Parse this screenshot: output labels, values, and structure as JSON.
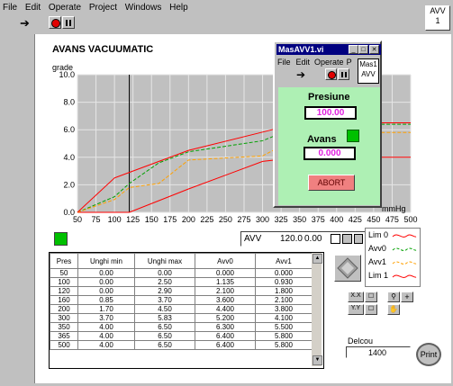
{
  "menu": [
    "File",
    "Edit",
    "Operate",
    "Project",
    "Windows",
    "Help"
  ],
  "corner_label": "AVV\n1",
  "title": "AVANS VACUUMATIC",
  "ylabel": "grade",
  "xunit": "mmHg",
  "chart_data": {
    "type": "line",
    "x_ticks": [
      50,
      75,
      100,
      125,
      150,
      175,
      200,
      225,
      250,
      275,
      300,
      325,
      350,
      375,
      400,
      425,
      450,
      475,
      500
    ],
    "y_ticks": [
      "0.0",
      "2.0",
      "4.0",
      "6.0",
      "8.0",
      "10.0"
    ],
    "xlim": [
      50,
      500
    ],
    "ylim": [
      0,
      10
    ],
    "cursor_x": 120,
    "series": [
      {
        "name": "Lim 0",
        "color": "#ff0000",
        "x": [
          50,
          100,
          120,
          160,
          200,
          300,
          350,
          500
        ],
        "y": [
          0,
          0,
          0,
          0.85,
          1.7,
          3.7,
          4,
          4
        ]
      },
      {
        "name": "Avv0",
        "color": "#00a000",
        "x": [
          50,
          100,
          120,
          160,
          200,
          300,
          350,
          365,
          500
        ],
        "y": [
          0,
          1.135,
          2.1,
          3.6,
          4.4,
          5.2,
          6.3,
          6.4,
          6.4
        ]
      },
      {
        "name": "Avv1",
        "color": "#ffa000",
        "x": [
          50,
          100,
          120,
          160,
          200,
          300,
          350,
          365,
          500
        ],
        "y": [
          0,
          0.93,
          1.8,
          2.1,
          3.8,
          4.1,
          5.5,
          5.8,
          5.8
        ]
      },
      {
        "name": "Lim 1",
        "color": "#ff0000",
        "x": [
          50,
          100,
          120,
          160,
          200,
          300,
          350,
          365,
          500
        ],
        "y": [
          0,
          2.5,
          2.9,
          3.7,
          4.5,
          5.83,
          6.5,
          6.5,
          6.5
        ]
      }
    ]
  },
  "cursor_panel": {
    "name": "AVV",
    "x": "120.0",
    "y": "0.00"
  },
  "legend": [
    "Lim 0",
    "Avv0",
    "Avv1",
    "Lim 1"
  ],
  "table": {
    "headers": [
      "Pres",
      "Unghi min",
      "Unghi max",
      "Avv0",
      "Avv1"
    ],
    "rows": [
      [
        "50",
        "0.00",
        "0.00",
        "0.000",
        "0.000"
      ],
      [
        "100",
        "0.00",
        "2.50",
        "1.135",
        "0.930"
      ],
      [
        "120",
        "0.00",
        "2.90",
        "2.100",
        "1.800"
      ],
      [
        "160",
        "0.85",
        "3.70",
        "3.600",
        "2.100"
      ],
      [
        "200",
        "1.70",
        "4.50",
        "4.400",
        "3.800"
      ],
      [
        "300",
        "3.70",
        "5.83",
        "5.200",
        "4.100"
      ],
      [
        "350",
        "4.00",
        "6.50",
        "6.300",
        "5.500"
      ],
      [
        "365",
        "4.00",
        "6.50",
        "6.400",
        "5.800"
      ],
      [
        "500",
        "4.00",
        "6.50",
        "6.400",
        "5.800"
      ]
    ]
  },
  "delcou": {
    "label": "Delcou",
    "value": "1400"
  },
  "print_label": "Print",
  "popup": {
    "title": "MasAVV1.vi",
    "menu": [
      "File",
      "Edit",
      "Operate",
      "P"
    ],
    "corner": "Mas1\nAVV",
    "presiune_label": "Presiune",
    "presiune_value": "100.00",
    "avans_label": "Avans",
    "avans_value": "0.000",
    "abort_label": "ABORT"
  }
}
